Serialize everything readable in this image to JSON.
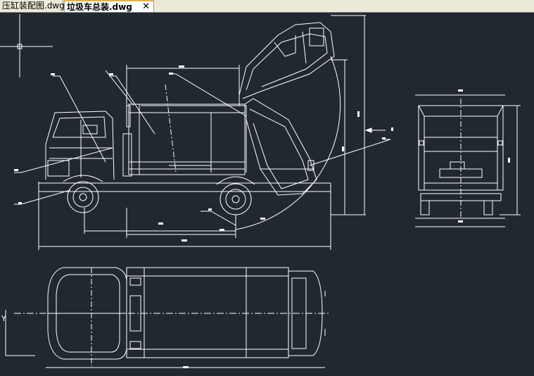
{
  "tabs": [
    {
      "label": "压缸装配图.dwg",
      "active": false
    },
    {
      "label": "垃圾车总装.dwg",
      "active": true
    }
  ],
  "close_glyph": "✕",
  "ucs_label": "Y",
  "colors": {
    "background": "#212830",
    "lines": "#ffffff",
    "active_tab_accent": "#f0b030"
  }
}
